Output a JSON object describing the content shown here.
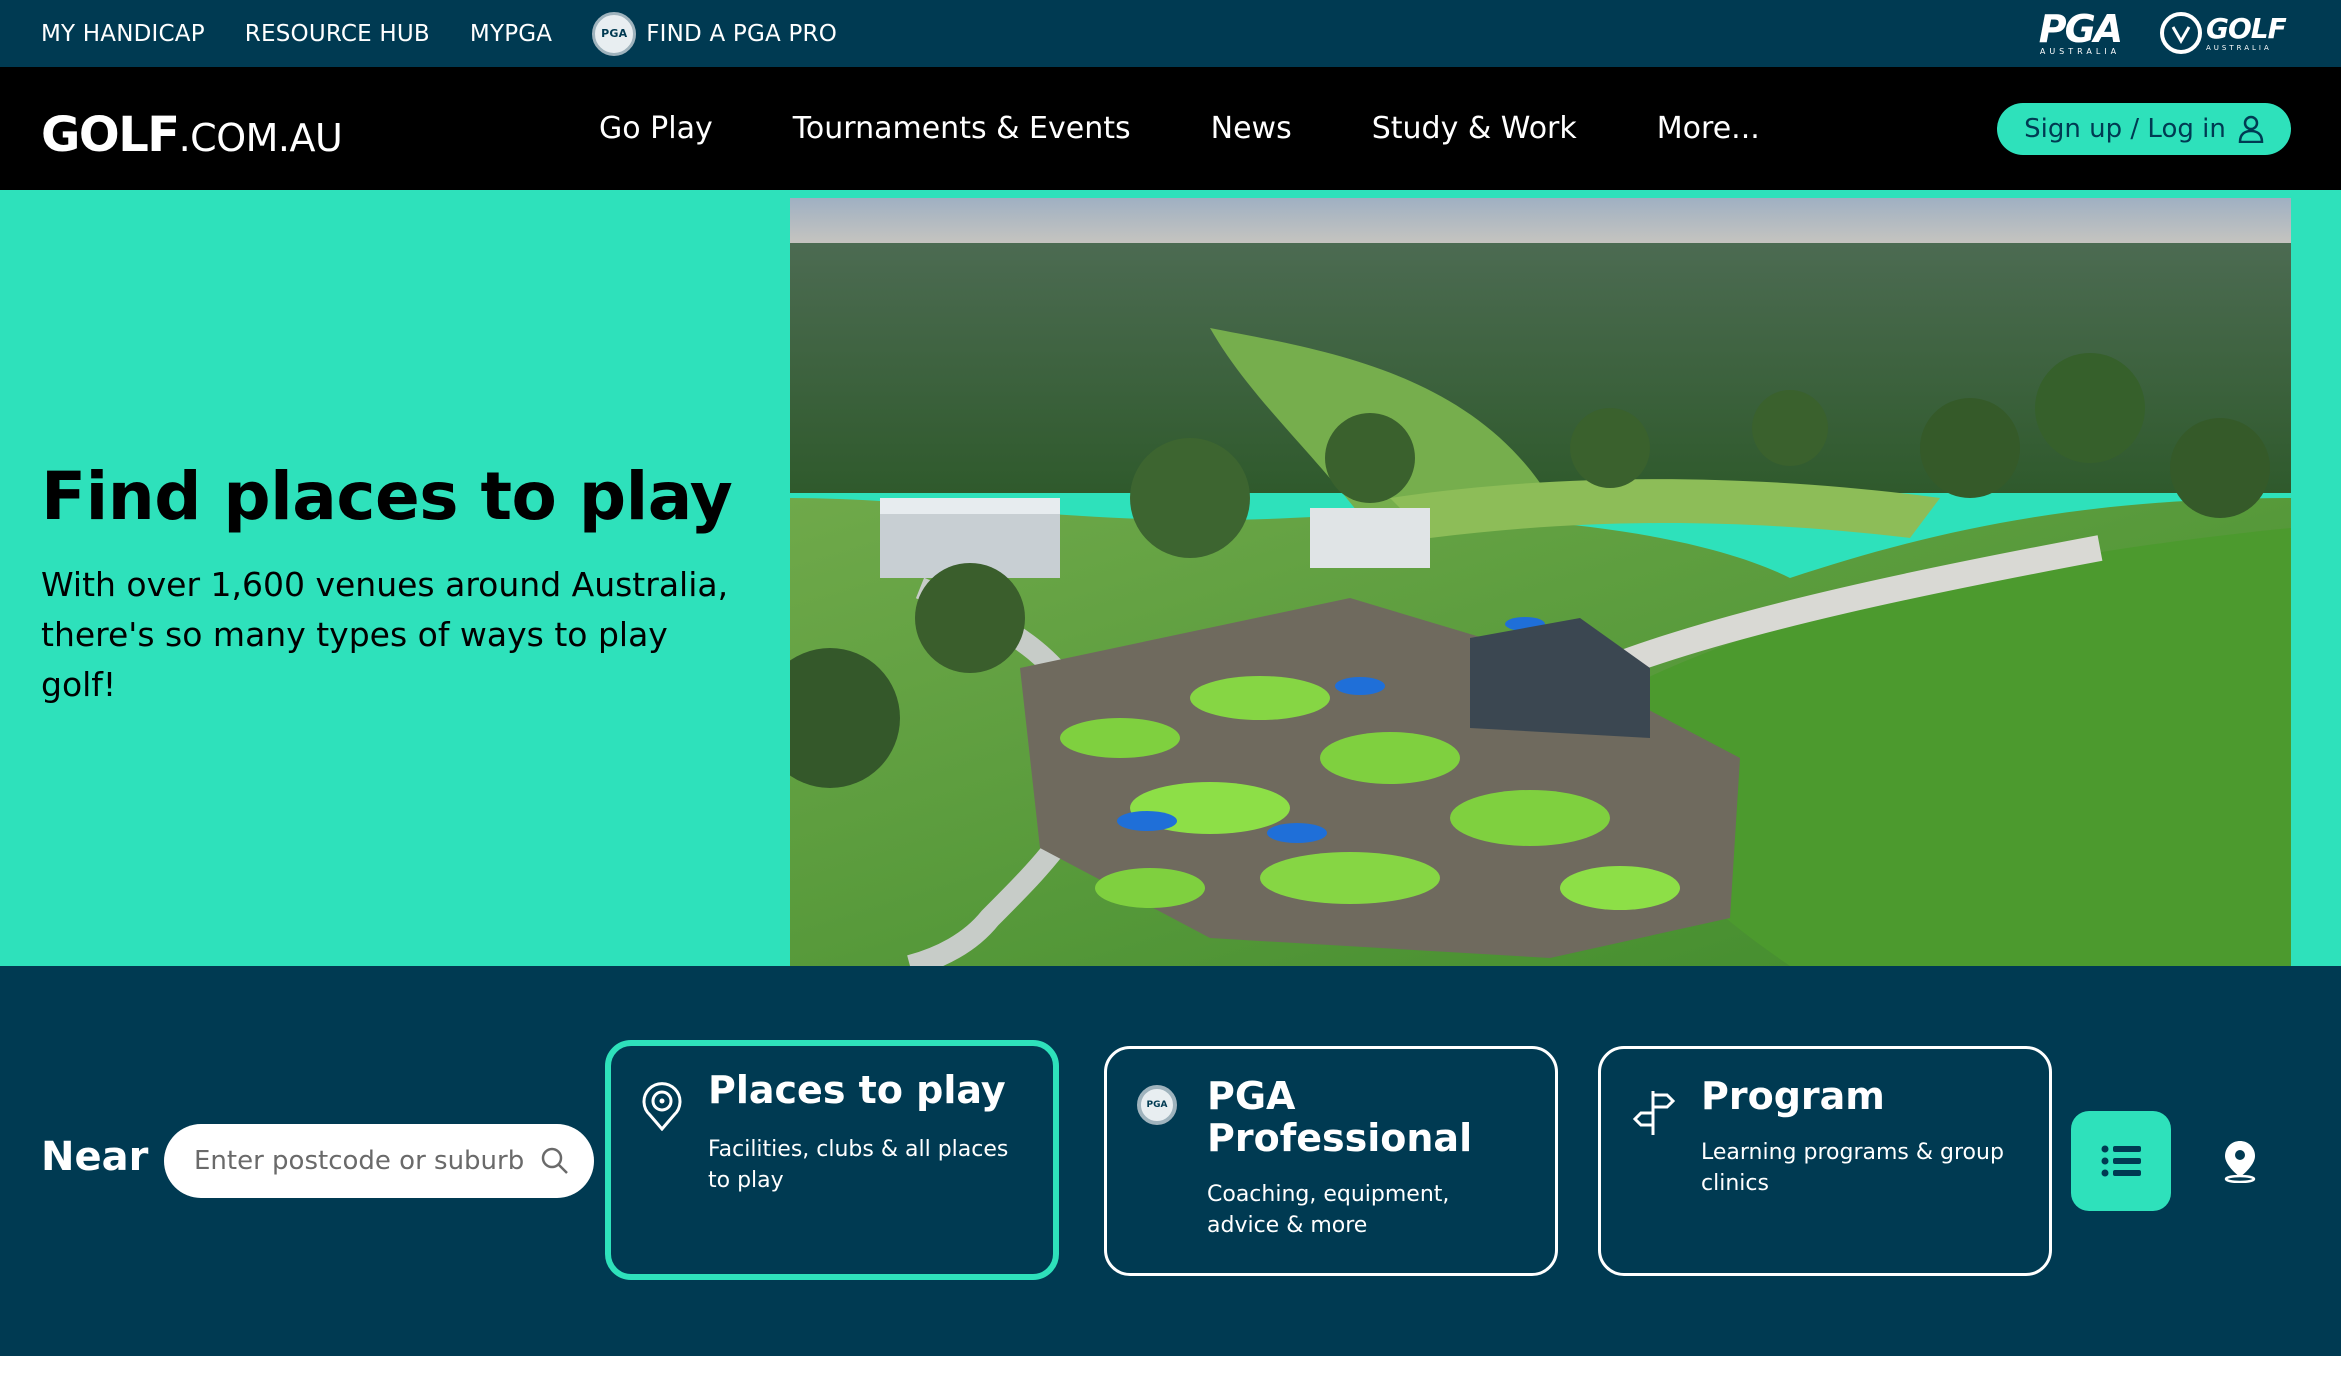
{
  "utility_bar": {
    "links": [
      "MY HANDICAP",
      "RESOURCE HUB",
      "MYPGA",
      "FIND A PGA PRO"
    ],
    "pga_badge": "PGA",
    "brand_pga": {
      "name": "PGA",
      "tagline": "AUSTRALIA"
    },
    "brand_golf_australia": {
      "name": "GOLF",
      "tagline": "AUSTRALIA"
    }
  },
  "header": {
    "logo_bold": "GOLF",
    "logo_light": ".COM.AU",
    "nav": [
      "Go Play",
      "Tournaments & Events",
      "News",
      "Study & Work",
      "More..."
    ],
    "signup_label": "Sign up / Log in"
  },
  "hero": {
    "title": "Find places to play",
    "subtitle": "With over 1,600 venues around Australia, there's so many types of ways to play golf!"
  },
  "search": {
    "near_label": "Near",
    "placeholder": "Enter postcode or suburb",
    "cards": [
      {
        "title": "Places to play",
        "description": "Facilities, clubs & all places to play",
        "icon": "location-target-icon",
        "active": true
      },
      {
        "title": "PGA Professional",
        "description": "Coaching, equipment, advice & more",
        "icon": "pga-badge-icon",
        "active": false
      },
      {
        "title": "Program",
        "description": "Learning programs & group clinics",
        "icon": "signpost-icon",
        "active": false
      }
    ],
    "view_toggles": [
      {
        "icon": "list-view-icon",
        "active": true
      },
      {
        "icon": "map-pin-icon",
        "active": false
      }
    ]
  },
  "colors": {
    "navy": "#003a52",
    "black": "#000000",
    "mint": "#2ee1bb",
    "white": "#ffffff"
  }
}
